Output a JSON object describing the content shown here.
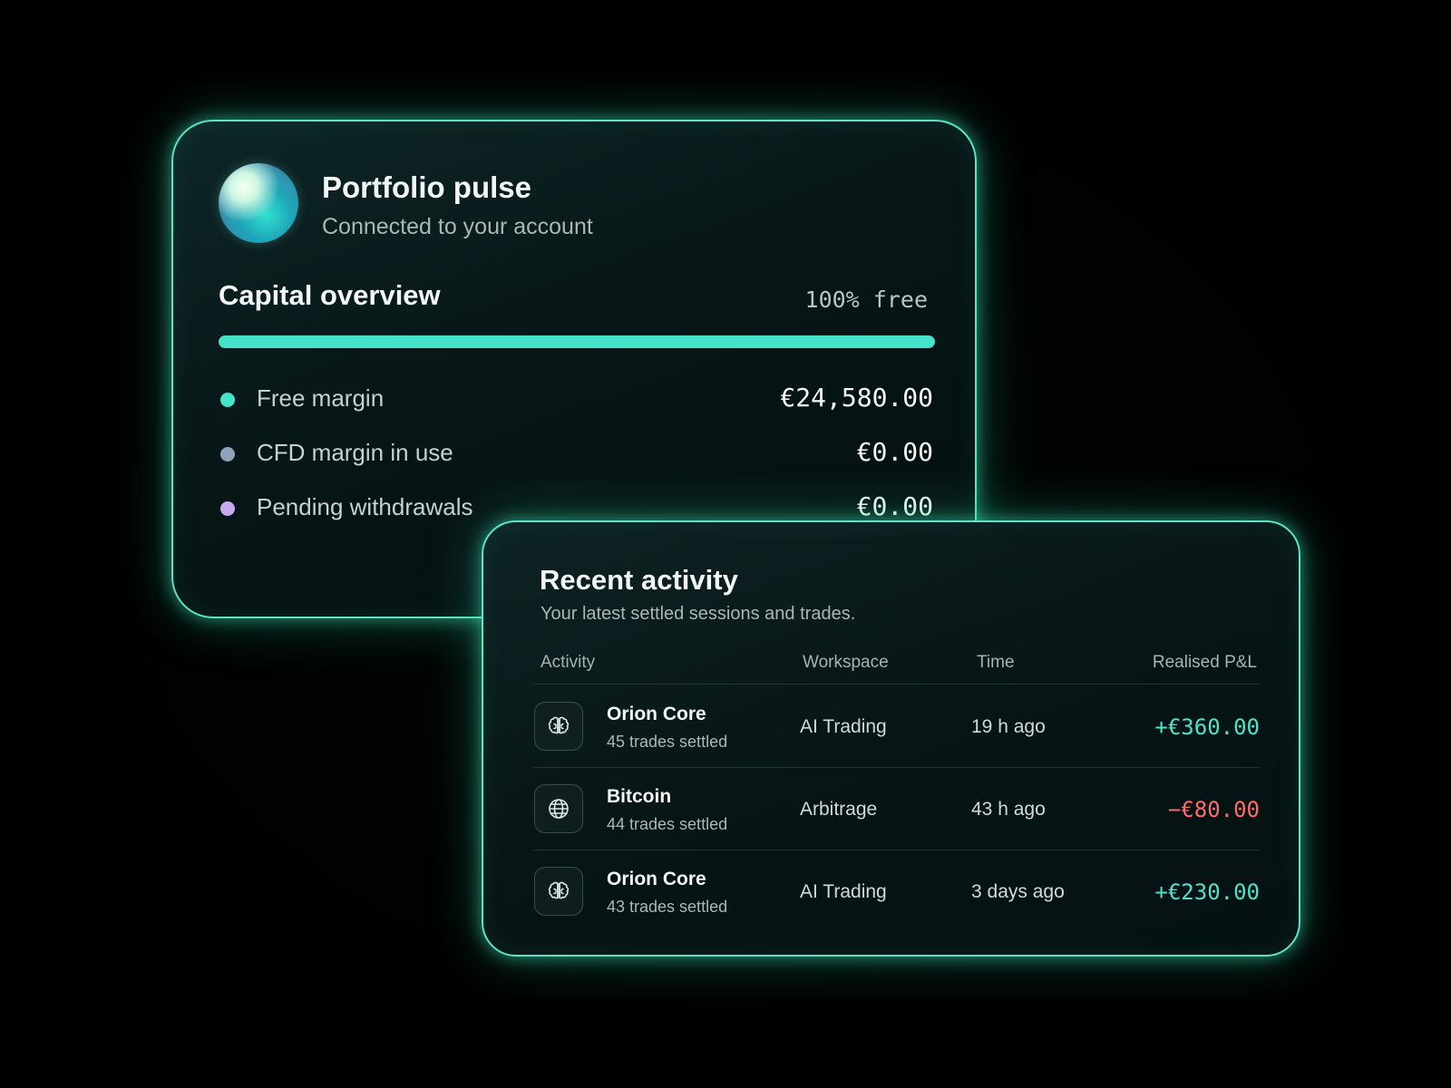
{
  "portfolio": {
    "title": "Portfolio pulse",
    "subtitle": "Connected to your account",
    "capital_title": "Capital overview",
    "capital_free_label": "100% free",
    "capital_free_fraction": 1.0,
    "bar_color": "#45e3c9",
    "rows": [
      {
        "label": "Free margin",
        "value": "€24,580.00",
        "dot_color": "#45e3c9"
      },
      {
        "label": "CFD margin in use",
        "value": "€0.00",
        "dot_color": "#8fa3b9"
      },
      {
        "label": "Pending withdrawals",
        "value": "€0.00",
        "dot_color": "#c7a9f0"
      }
    ]
  },
  "activity": {
    "title": "Recent activity",
    "subtitle": "Your latest settled sessions and trades.",
    "columns": [
      "Activity",
      "Workspace",
      "Time",
      "Realised P&L"
    ],
    "rows": [
      {
        "icon": "brain-icon",
        "name": "Orion Core",
        "detail": "45 trades settled",
        "workspace": "AI Trading",
        "time": "19 h ago",
        "pnl": "+€360.00",
        "pnl_color": "#4fe3cc"
      },
      {
        "icon": "globe-icon",
        "name": "Bitcoin",
        "detail": "44 trades settled",
        "workspace": "Arbitrage",
        "time": "43 h ago",
        "pnl": "−€80.00",
        "pnl_color": "#ff6b6b"
      },
      {
        "icon": "brain-icon",
        "name": "Orion Core",
        "detail": "43 trades settled",
        "workspace": "AI Trading",
        "time": "3 days ago",
        "pnl": "+€230.00",
        "pnl_color": "#4fe3cc"
      }
    ]
  },
  "colors": {
    "accent": "#45e3c9",
    "glow": "#5fe3c6",
    "positive": "#4fe3cc",
    "negative": "#ff6b6b"
  }
}
